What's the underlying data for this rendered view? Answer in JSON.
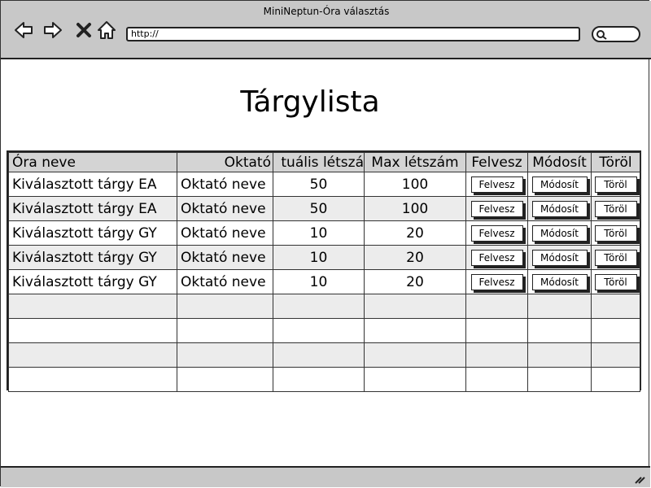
{
  "window": {
    "title": "MiniNeptun-Óra választás"
  },
  "toolbar": {
    "url": "http://",
    "icons": [
      "back-arrow-icon",
      "forward-arrow-icon",
      "close-icon",
      "home-icon",
      "search-icon"
    ]
  },
  "page": {
    "title": "Tárgylista"
  },
  "table": {
    "headers": [
      "Óra neve",
      "Oktató",
      "tuális létszá",
      "Max létszám",
      "Felvesz",
      "Módosít",
      "Töröl"
    ],
    "rows": [
      {
        "name": "Kiválasztott tárgy EA",
        "teacher": "Oktató neve",
        "current": "50",
        "max": "100"
      },
      {
        "name": "Kiválasztott tárgy EA",
        "teacher": "Oktató neve",
        "current": "50",
        "max": "100"
      },
      {
        "name": "Kiválasztott tárgy GY",
        "teacher": "Oktató neve",
        "current": "10",
        "max": "20"
      },
      {
        "name": "Kiválasztott tárgy GY",
        "teacher": "Oktató neve",
        "current": "10",
        "max": "20"
      },
      {
        "name": "Kiválasztott tárgy GY",
        "teacher": "Oktató neve",
        "current": "10",
        "max": "20"
      }
    ],
    "empty_rows": 4,
    "buttons": {
      "add": "Felvesz",
      "edit": "Módosít",
      "delete": "Töröl"
    }
  }
}
